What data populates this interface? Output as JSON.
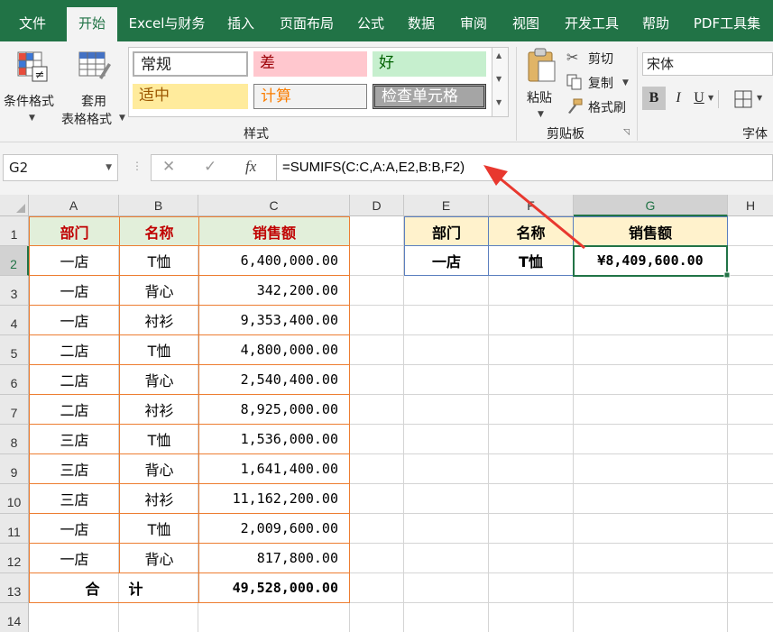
{
  "tabs": [
    "文件",
    "开始",
    "Excel与财务",
    "插入",
    "页面布局",
    "公式",
    "数据",
    "审阅",
    "视图",
    "开发工具",
    "帮助",
    "PDF工具集"
  ],
  "ribbon": {
    "conditional_format": "条件格式",
    "table_format_line1": "套用",
    "table_format_line2": "表格格式",
    "styles_group": "样式",
    "styles": {
      "normal": "常规",
      "bad": "差",
      "good": "好",
      "neutral": "适中",
      "calculation": "计算",
      "check_cell": "检查单元格"
    },
    "paste": "粘贴",
    "cut": "剪切",
    "copy": "复制",
    "format_painter": "格式刷",
    "clipboard_group": "剪贴板",
    "font_name": "宋体",
    "bold": "B",
    "italic": "I",
    "underline": "U",
    "font_group": "字体"
  },
  "formula_bar": {
    "name_box": "G2",
    "cancel": "✕",
    "enter": "✓",
    "fx": "fx",
    "formula": "=SUMIFS(C:C,A:A,E2,B:B,F2)"
  },
  "columns": [
    "A",
    "B",
    "C",
    "D",
    "E",
    "F",
    "G",
    "H"
  ],
  "rows": [
    "1",
    "2",
    "3",
    "4",
    "5",
    "6",
    "7",
    "8",
    "9",
    "10",
    "11",
    "12",
    "13",
    "14"
  ],
  "source_table": {
    "headers": [
      "部门",
      "名称",
      "销售额"
    ],
    "data": [
      [
        "一店",
        "T恤",
        "6,400,000.00"
      ],
      [
        "一店",
        "背心",
        "342,200.00"
      ],
      [
        "一店",
        "衬衫",
        "9,353,400.00"
      ],
      [
        "二店",
        "T恤",
        "4,800,000.00"
      ],
      [
        "二店",
        "背心",
        "2,540,400.00"
      ],
      [
        "二店",
        "衬衫",
        "8,925,000.00"
      ],
      [
        "三店",
        "T恤",
        "1,536,000.00"
      ],
      [
        "三店",
        "背心",
        "1,641,400.00"
      ],
      [
        "三店",
        "衬衫",
        "11,162,200.00"
      ],
      [
        "一店",
        "T恤",
        "2,009,600.00"
      ],
      [
        "一店",
        "背心",
        "817,800.00"
      ]
    ],
    "total_label": "合　　计",
    "total_value": "49,528,000.00"
  },
  "lookup_table": {
    "headers": [
      "部门",
      "名称",
      "销售额"
    ],
    "values": [
      "一店",
      "T恤",
      "¥8,409,600.00"
    ]
  },
  "colors": {
    "excel_green": "#217346",
    "header_red": "#c00000",
    "source_header_fill": "#e2efda",
    "source_border": "#ed7d31",
    "lookup_header_fill": "#fff2cc",
    "lookup_border": "#5b7fbf",
    "arrow": "#e8382f"
  }
}
